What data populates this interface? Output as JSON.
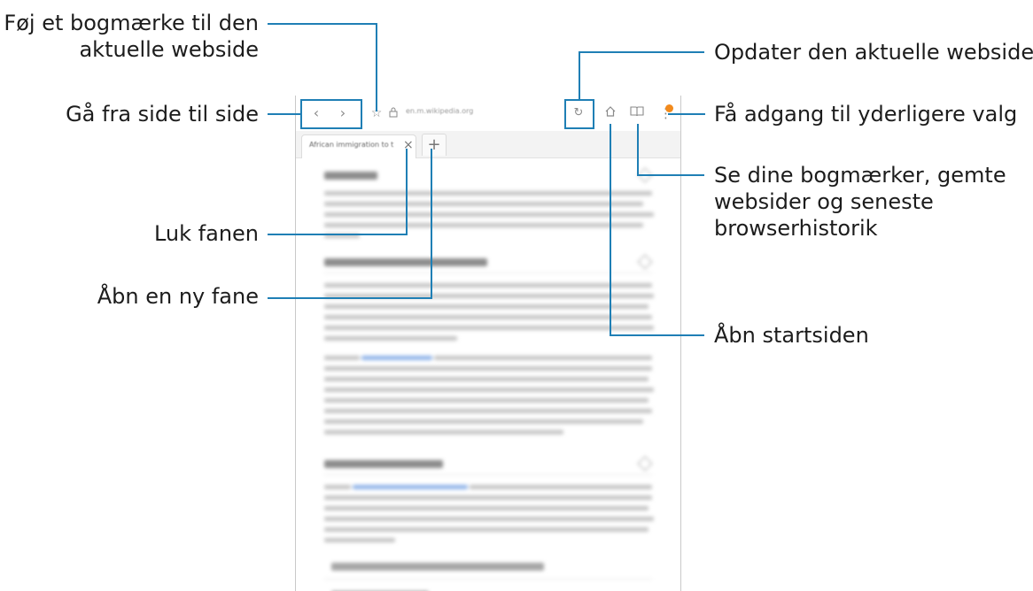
{
  "callouts": {
    "bookmark_line1": "Føj et bogmærke til den",
    "bookmark_line2": "aktuelle webside",
    "navigate": "Gå fra side til side",
    "close_tab": "Luk fanen",
    "new_tab": "Åbn en ny fane",
    "refresh": "Opdater den aktuelle webside",
    "more_options": "Få adgang til yderligere valg",
    "bookmarks_line1": "Se dine bogmærker, gemte",
    "bookmarks_line2": "websider og seneste",
    "bookmarks_line3": "browserhistorik",
    "home": "Åbn startsiden"
  },
  "browser": {
    "url": "en.m.wikipedia.org",
    "tab_title": "African immigration to t...",
    "tab_close_glyph": "×",
    "new_tab_glyph": "+",
    "notification_count": "1"
  },
  "icons": {
    "back": "chevron-left-icon",
    "forward": "chevron-right-icon",
    "bookmark": "star-icon",
    "lock": "lock-icon",
    "refresh": "refresh-icon",
    "home": "home-icon",
    "bookmarks": "book-icon",
    "more": "more-vertical-icon"
  },
  "colors": {
    "callout_line": "#1f7fb5",
    "badge": "#f28a1c"
  }
}
